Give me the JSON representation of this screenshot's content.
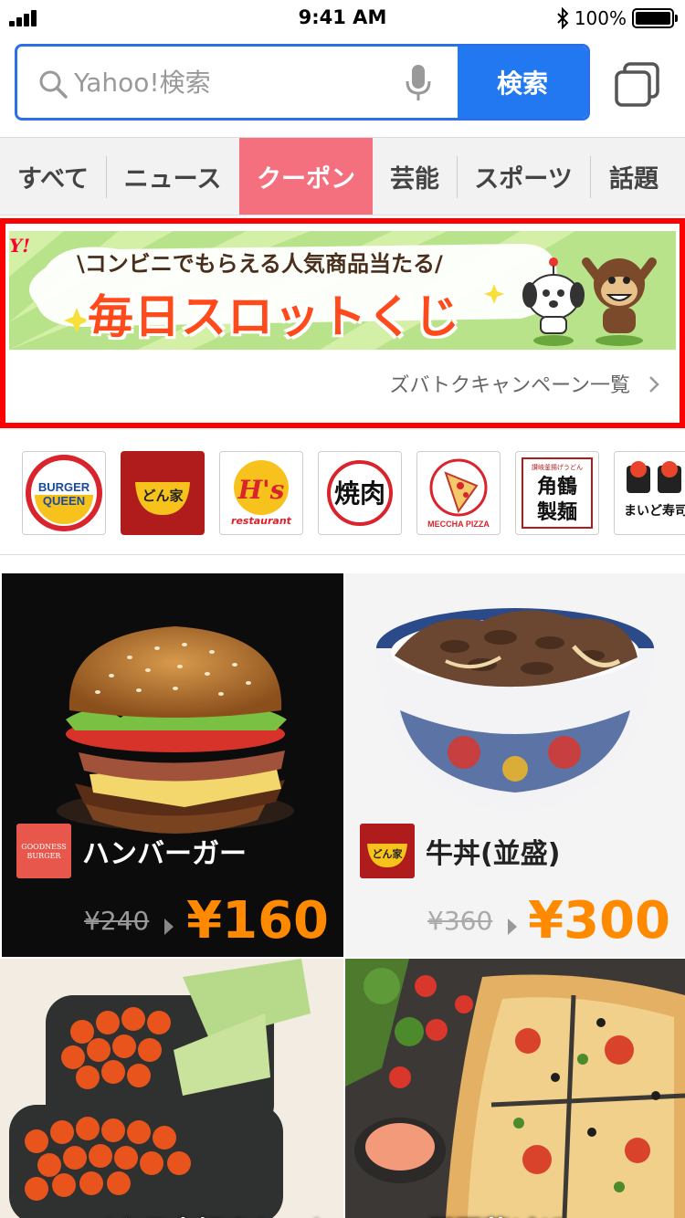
{
  "status_bar": {
    "time": "9:41 AM",
    "battery_pct": "100%",
    "icons": [
      "signal-icon",
      "bluetooth-icon",
      "battery-icon"
    ]
  },
  "search": {
    "placeholder": "Yahoo!検索",
    "button_label": "検索",
    "icons": [
      "search-icon",
      "mic-icon",
      "tabs-icon"
    ]
  },
  "category_tabs": [
    {
      "label": "すべて",
      "active": false
    },
    {
      "label": "ニュース",
      "active": false
    },
    {
      "label": "クーポン",
      "active": true
    },
    {
      "label": "芸能",
      "active": false
    },
    {
      "label": "スポーツ",
      "active": false
    },
    {
      "label": "話題",
      "active": false
    }
  ],
  "banner": {
    "logo": "Y!",
    "subtitle": "\\コンビニでもらえる人気商品当たる/",
    "title": "毎日スロットくじ",
    "link_label": "ズバトクキャンペーン一覧"
  },
  "brand_logos": [
    {
      "name": "BURGER QUEEN",
      "line1": "BURGER",
      "line2": "QUEEN"
    },
    {
      "name": "どん家",
      "label": "どん家"
    },
    {
      "name": "H's restaurant",
      "line1": "H's",
      "line2": "restaurant"
    },
    {
      "name": "焼肉",
      "label": "焼肉"
    },
    {
      "name": "MECCHA PIZZA",
      "label": "MECCHA PIZZA"
    },
    {
      "name": "角鶴製麺",
      "top": "讃岐釜揚げうどん",
      "line1": "角鶴",
      "line2": "製麺"
    },
    {
      "name": "まいど寿司",
      "label": "まいど寿司"
    }
  ],
  "food_cards": [
    {
      "name": "ハンバーガー",
      "brand_logo": "GOODNESS BURGER",
      "brand_line1": "GOODNESS",
      "brand_line2": "BURGER",
      "old_price": "¥240",
      "price": "¥160"
    },
    {
      "name": "牛丼(並盛)",
      "brand_logo": "どん家",
      "old_price": "¥360",
      "price": "¥300"
    },
    {
      "name": "イクラ大好きセット"
    },
    {
      "name": "夏野菜ピザ"
    }
  ],
  "colors": {
    "search_border": "#2c6fe8",
    "search_button": "#2178f0",
    "active_tab": "#f5707f",
    "banner_frame": "#ff0000",
    "price": "#ff8a00"
  }
}
